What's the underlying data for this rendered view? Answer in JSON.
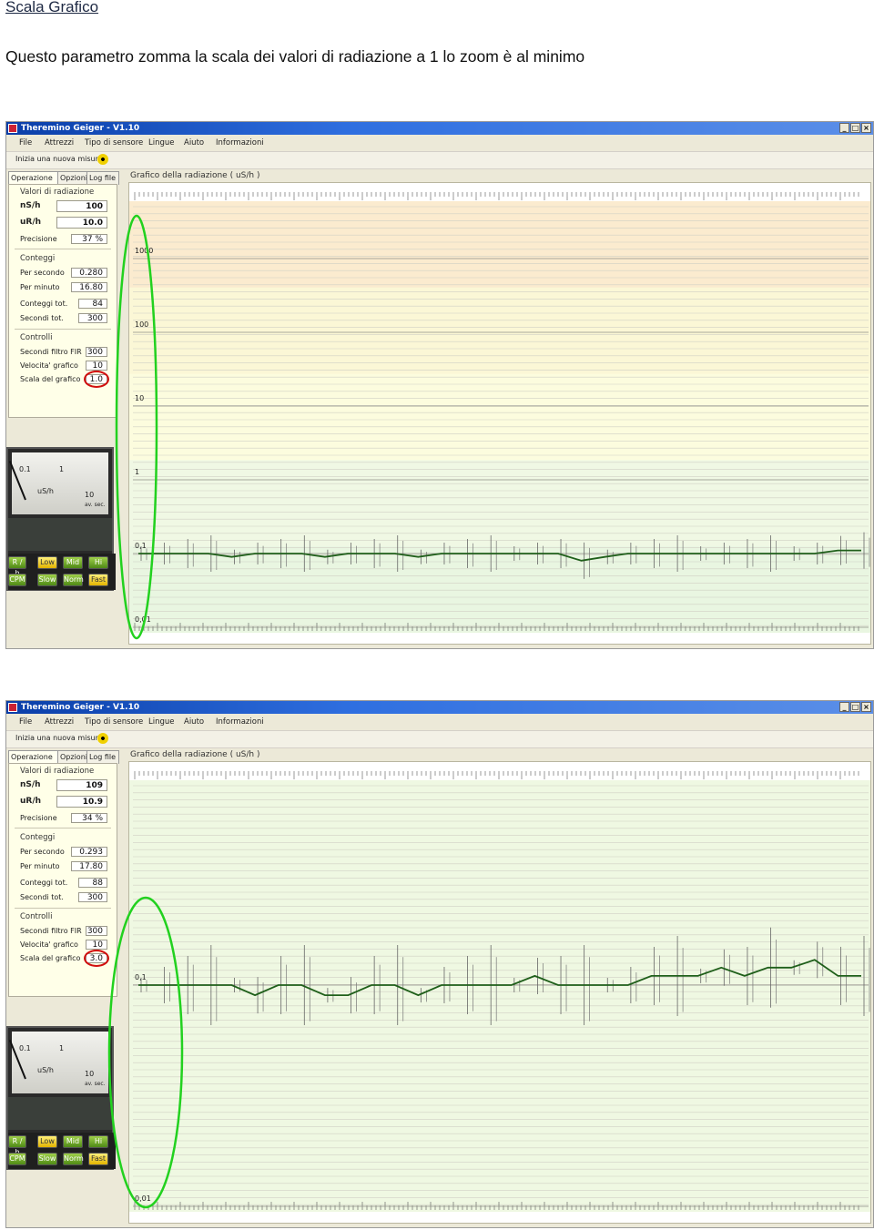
{
  "doc": {
    "heading": "Scala Grafico",
    "description": "Questo parametro zomma la scala dei valori di radiazione a 1 lo zoom è al minimo"
  },
  "screenshots": [
    {
      "window_title": "Theremino Geiger - V1.10",
      "menu": [
        "File",
        "Attrezzi",
        "Tipo di sensore",
        "Lingue",
        "Aiuto",
        "Informazioni"
      ],
      "toolbar_start": "Inizia una nuova misura",
      "tabs": [
        "Operazione",
        "Opzioni",
        "Log file"
      ],
      "valori_group": "Valori di radiazione",
      "ns_label": "nS/h",
      "ns_value": "100",
      "ur_label": "uR/h",
      "ur_value": "10.0",
      "precisione_label": "Precisione",
      "precisione_value": "37 %",
      "conteggi_group": "Conteggi",
      "per_secondo_label": "Per secondo",
      "per_secondo_value": "0.280",
      "per_minuto_label": "Per minuto",
      "per_minuto_value": "16.80",
      "conteggi_tot_label": "Conteggi tot.",
      "conteggi_tot_value": "84",
      "secondi_tot_label": "Secondi tot.",
      "secondi_tot_value": "300",
      "controlli_group": "Controlli",
      "fir_label": "Secondi filtro FIR",
      "fir_value": "300",
      "velocita_label": "Velocita' grafico",
      "velocita_value": "10",
      "scala_label": "Scala del grafico",
      "scala_value": "1.0",
      "meter_unit": "uS/h",
      "meter_scale": [
        "0.1",
        "1",
        "10"
      ],
      "meter_caption": "av. sec.",
      "buttons_row1": [
        "R / h",
        "Low",
        "Mid",
        "Hi"
      ],
      "buttons_row2": [
        "CPM",
        "Slow",
        "Norm",
        "Fast"
      ],
      "graph_title": "Grafico della radiazione ( uS/h )",
      "chart_data": {
        "type": "line",
        "y_scale": "log",
        "y_tick_labels": [
          "1000",
          "100",
          "10",
          "1",
          "0,1",
          "0,01"
        ],
        "zoom": 1.0,
        "series": [
          {
            "values": [
              0.1,
              0.1,
              0.1,
              0.1,
              0.09,
              0.1,
              0.1,
              0.1,
              0.09,
              0.1,
              0.1,
              0.1,
              0.09,
              0.1,
              0.1,
              0.1,
              0.1,
              0.1,
              0.1,
              0.08,
              0.09,
              0.1,
              0.1,
              0.1,
              0.1,
              0.1,
              0.1,
              0.1,
              0.1,
              0.1,
              0.11,
              0.11
            ]
          }
        ],
        "band_colors": [
          "#fbebcf",
          "#fbf7d6",
          "#fcfcde",
          "#f0f8e4",
          "#e9f6e1"
        ]
      }
    },
    {
      "window_title": "Theremino Geiger - V1.10",
      "menu": [
        "File",
        "Attrezzi",
        "Tipo di sensore",
        "Lingue",
        "Aiuto",
        "Informazioni"
      ],
      "toolbar_start": "Inizia una nuova misura",
      "tabs": [
        "Operazione",
        "Opzioni",
        "Log file"
      ],
      "valori_group": "Valori di radiazione",
      "ns_label": "nS/h",
      "ns_value": "109",
      "ur_label": "uR/h",
      "ur_value": "10.9",
      "precisione_label": "Precisione",
      "precisione_value": "34 %",
      "conteggi_group": "Conteggi",
      "per_secondo_label": "Per secondo",
      "per_secondo_value": "0.293",
      "per_minuto_label": "Per minuto",
      "per_minuto_value": "17.80",
      "conteggi_tot_label": "Conteggi tot.",
      "conteggi_tot_value": "88",
      "secondi_tot_label": "Secondi tot.",
      "secondi_tot_value": "300",
      "controlli_group": "Controlli",
      "fir_label": "Secondi filtro FIR",
      "fir_value": "300",
      "velocita_label": "Velocita' grafico",
      "velocita_value": "10",
      "scala_label": "Scala del grafico",
      "scala_value": "3.0",
      "meter_unit": "uS/h",
      "meter_scale": [
        "0.1",
        "1",
        "10"
      ],
      "meter_caption": "av. sec.",
      "buttons_row1": [
        "R / h",
        "Low",
        "Mid",
        "Hi"
      ],
      "buttons_row2": [
        "CPM",
        "Slow",
        "Norm",
        "Fast"
      ],
      "graph_title": "Grafico della radiazione ( uS/h )",
      "chart_data": {
        "type": "line",
        "y_scale": "log",
        "y_tick_labels": [
          "0,1",
          "0,01"
        ],
        "zoom": 3.0,
        "series": [
          {
            "values": [
              0.1,
              0.1,
              0.1,
              0.1,
              0.1,
              0.09,
              0.1,
              0.1,
              0.09,
              0.09,
              0.1,
              0.1,
              0.09,
              0.1,
              0.1,
              0.1,
              0.1,
              0.11,
              0.1,
              0.1,
              0.1,
              0.1,
              0.11,
              0.11,
              0.11,
              0.12,
              0.11,
              0.12,
              0.12,
              0.13,
              0.11,
              0.11
            ]
          }
        ],
        "band_colors": [
          "#eff8e2",
          "#eff8e2",
          "#eff8e2",
          "#eff8e2",
          "#eff8e2"
        ]
      }
    }
  ]
}
